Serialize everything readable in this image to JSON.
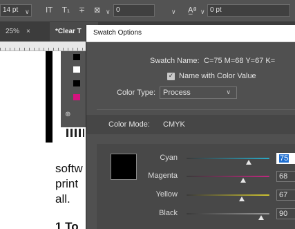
{
  "control_bar": {
    "font_size_value": "14 pt",
    "kerning_value": "0",
    "baseline_value": "0 pt"
  },
  "tabs": [
    {
      "label": "25%",
      "close": "×",
      "active": false
    },
    {
      "label": "*Clear T",
      "active": true
    }
  ],
  "document": {
    "text_lines": [
      "softw",
      "print",
      "all."
    ],
    "bullet_fragment": "1 To"
  },
  "swatch_panel": {
    "chip_colors": [
      "#000000",
      "#ffffff",
      "#000000",
      "#d6127f"
    ]
  },
  "dialog": {
    "title": "Swatch Options",
    "swatch_name_label": "Swatch Name:",
    "swatch_name_value": "C=75 M=68 Y=67 K=",
    "name_with_color_value_label": "Name with Color Value",
    "name_with_color_value_checked": true,
    "color_type_label": "Color Type:",
    "color_type_value": "Process",
    "color_mode_label": "Color Mode:",
    "color_mode_value": "CMYK",
    "preview_color": "#000000",
    "sliders": [
      {
        "name": "cyan",
        "label": "Cyan",
        "value": "75",
        "fraction": 0.75,
        "color": "#2aa9c6",
        "focused": true
      },
      {
        "name": "magenta",
        "label": "Magenta",
        "value": "68",
        "fraction": 0.68,
        "color": "#c0287f",
        "focused": false
      },
      {
        "name": "yellow",
        "label": "Yellow",
        "value": "67",
        "fraction": 0.67,
        "color": "#cfc431",
        "focused": false
      },
      {
        "name": "black",
        "label": "Black",
        "value": "90",
        "fraction": 0.9,
        "color": "#9a9a9a",
        "focused": false
      }
    ]
  }
}
